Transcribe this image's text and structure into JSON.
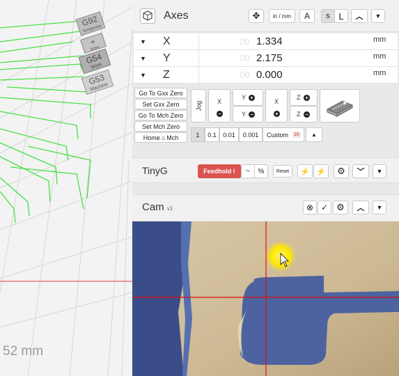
{
  "viewport": {
    "unit_readout": "52 mm",
    "offset_labels": [
      {
        "code": "G92",
        "sub": "Temporary"
      },
      {
        "code": "+",
        "sub": "Axes"
      },
      {
        "code": "G54",
        "sub": "Work"
      },
      {
        "code": "G53",
        "sub": "Machine"
      }
    ]
  },
  "axes": {
    "title": "Axes",
    "header_buttons": {
      "units": "in / mm",
      "s_label": "s",
      "l_label": "L"
    },
    "rows": [
      {
        "letter": "X",
        "ghost": "00",
        "value": "1.334",
        "unit": "mm"
      },
      {
        "letter": "Y",
        "ghost": "00",
        "value": "2.175",
        "unit": "mm"
      },
      {
        "letter": "Z",
        "ghost": "00",
        "value": "0.000",
        "unit": "mm"
      }
    ],
    "zero_buttons": [
      "Go To Gxx Zero",
      "Set Gxx Zero",
      "Go To Mch Zero",
      "Set Mch Zero",
      "Home",
      "Mch"
    ],
    "jog": {
      "label": "Jog",
      "x_label": "X",
      "y_label": "Y",
      "z_label": "Z",
      "plus": "+",
      "minus": "−"
    },
    "steps": [
      "1",
      "0.1",
      "0.01",
      "0.001",
      "Custom"
    ],
    "custom_value": "10"
  },
  "tinyg": {
    "title": "TinyG",
    "feedhold_label": "Feedhold !",
    "tilde_label": "~",
    "percent_label": "%",
    "reset_label": "Reset"
  },
  "cam": {
    "title": "Cam",
    "version": "v1"
  },
  "colors": {
    "toolpath": "#44e044",
    "feedhold": "#d9534f",
    "crosshair": "#e01010",
    "cursor_highlight": "#ffe800"
  }
}
